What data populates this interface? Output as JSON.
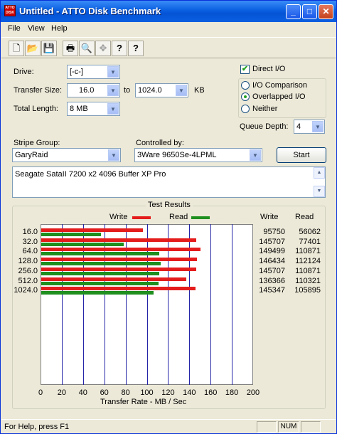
{
  "window": {
    "title": "Untitled - ATTO Disk Benchmark",
    "icon_text": "ATTO DISK",
    "minimize": "_",
    "maximize": "□",
    "close": "✕"
  },
  "menu": [
    "File",
    "View",
    "Help"
  ],
  "toolbar": {
    "icons": [
      "new-document-icon",
      "open-folder-icon",
      "save-disk-icon",
      "print-icon",
      "print-preview-icon",
      "move-icon",
      "help-icon",
      "context-help-icon"
    ],
    "glyphs": [
      "🗋",
      "📂",
      "💾",
      "🖶",
      "🔍",
      "✥",
      "?",
      "?"
    ]
  },
  "drive": {
    "label": "Drive:",
    "value": "[-c-]"
  },
  "transfer_size": {
    "label": "Transfer Size:",
    "from": "16.0",
    "to_label": "to",
    "to": "1024.0",
    "unit": "KB"
  },
  "total_length": {
    "label": "Total Length:",
    "value": "8 MB"
  },
  "direct_io": {
    "label": "Direct I/O",
    "checked": true,
    "mark": "✔"
  },
  "io_mode": {
    "options": [
      "I/O Comparison",
      "Overlapped I/O",
      "Neither"
    ],
    "selected": "Overlapped I/O"
  },
  "queue_depth": {
    "label": "Queue Depth:",
    "value": "4"
  },
  "stripe_group": {
    "label": "Stripe Group:",
    "value": "GaryRaid"
  },
  "controlled_by": {
    "label": "Controlled by:",
    "value": "3Ware 9650Se-4LPML"
  },
  "start_button": "Start",
  "description": "Seagate SataII 7200 x2  4096 Buffer XP Pro",
  "results": {
    "title": "Test Results",
    "legend_write": "Write",
    "legend_read": "Read",
    "col_write": "Write",
    "col_read": "Read",
    "write_color": "#e51c1c",
    "read_color": "#1f8f1f",
    "grid_color": "#2424a8"
  },
  "chart_data": {
    "type": "bar",
    "categories": [
      "16.0",
      "32.0",
      "64.0",
      "128.0",
      "256.0",
      "512.0",
      "1024.0"
    ],
    "series": [
      {
        "name": "Write",
        "values": [
          95.75,
          145.707,
          149.499,
          146.434,
          145.707,
          136.366,
          145.347
        ]
      },
      {
        "name": "Read",
        "values": [
          56.062,
          77.401,
          110.871,
          112.124,
          110.871,
          110.321,
          105.895
        ]
      }
    ],
    "write_text": [
      "95750",
      "145707",
      "149499",
      "146434",
      "145707",
      "136366",
      "145347"
    ],
    "read_text": [
      "56062",
      "77401",
      "110871",
      "112124",
      "110871",
      "110321",
      "105895"
    ],
    "xticks": [
      "0",
      "20",
      "40",
      "60",
      "80",
      "100",
      "120",
      "140",
      "160",
      "180",
      "200"
    ],
    "xlabel": "Transfer Rate - MB / Sec",
    "xlim": [
      0,
      200
    ],
    "orientation": "horizontal",
    "grid": true,
    "legend": "top"
  },
  "status": {
    "help": "For Help, press F1",
    "num": "NUM"
  }
}
